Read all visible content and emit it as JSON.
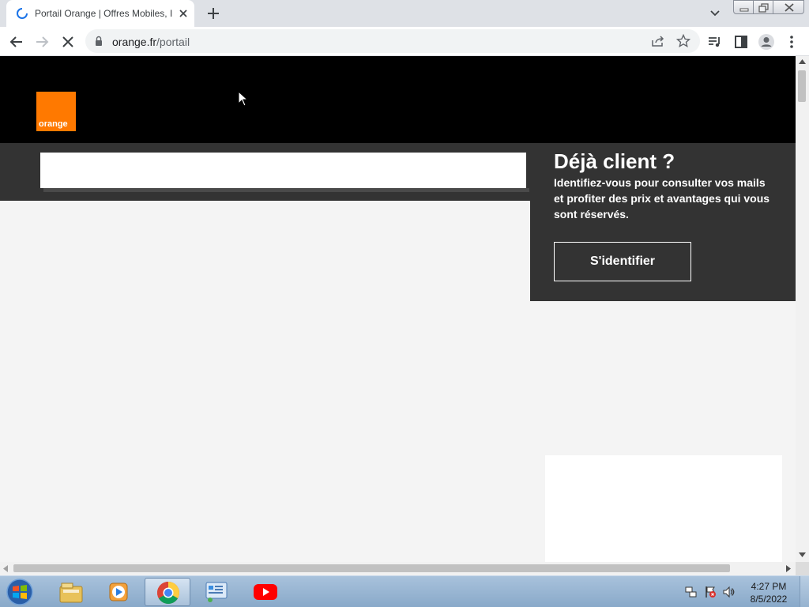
{
  "browser": {
    "tab": {
      "title": "Portail Orange | Offres Mobiles, I",
      "loading": true
    },
    "new_tab_icon": "plus-icon",
    "address": {
      "domain": "orange.fr",
      "path": "/portail"
    },
    "window_controls": [
      "minimize",
      "restore",
      "close"
    ]
  },
  "page": {
    "logo_text": "orange",
    "search_value": "",
    "login": {
      "title": "Déjà client ?",
      "description": "Identifiez-vous pour consulter vos mails et profiter des prix et avantages qui vous sont réservés.",
      "button_label": "S'identifier"
    },
    "colors": {
      "header": "#000000",
      "band": "#333333",
      "brand_orange": "#ff7900",
      "page_bg": "#f4f4f4"
    }
  },
  "taskbar": {
    "apps": [
      "windows-explorer",
      "windows-media-player",
      "google-chrome",
      "control-panel",
      "youtube"
    ],
    "active_app": "google-chrome",
    "clock": {
      "time": "4:27 PM",
      "date": "8/5/2022"
    }
  }
}
